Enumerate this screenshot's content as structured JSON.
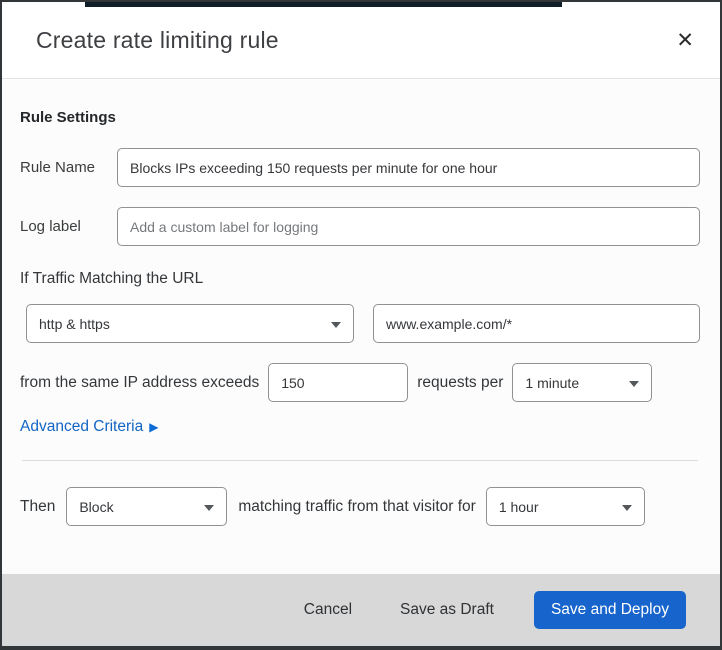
{
  "window": {
    "title": "Create rate limiting rule",
    "close_glyph": "✕"
  },
  "form": {
    "section_title": "Rule Settings",
    "rule_name": {
      "label": "Rule Name",
      "value": "Blocks IPs exceeding 150 requests per minute for one hour"
    },
    "log_label": {
      "label": "Log label",
      "placeholder": "Add a custom label for logging"
    },
    "traffic_match": {
      "heading": "If Traffic Matching the URL",
      "scheme_selected": "http & https",
      "url_value": "www.example.com/*"
    },
    "threshold": {
      "prefix": "from the same IP address exceeds",
      "requests_value": "150",
      "middle": "requests per",
      "period_selected": "1 minute"
    },
    "advanced_criteria": {
      "label": "Advanced Criteria",
      "arrow": "▶"
    },
    "then": {
      "label": "Then",
      "action_selected": "Block",
      "middle": "matching traffic from that visitor for",
      "duration_selected": "1 hour"
    }
  },
  "footer": {
    "cancel_label": "Cancel",
    "save_draft_label": "Save as Draft",
    "save_deploy_label": "Save and Deploy"
  },
  "colors": {
    "primary_blue": "#1765cc",
    "link_blue": "#1365c4",
    "footer_bg": "#d8d8d8",
    "input_border": "#8f9194",
    "top_accent": "#101e2a",
    "window_border": "#333639"
  }
}
